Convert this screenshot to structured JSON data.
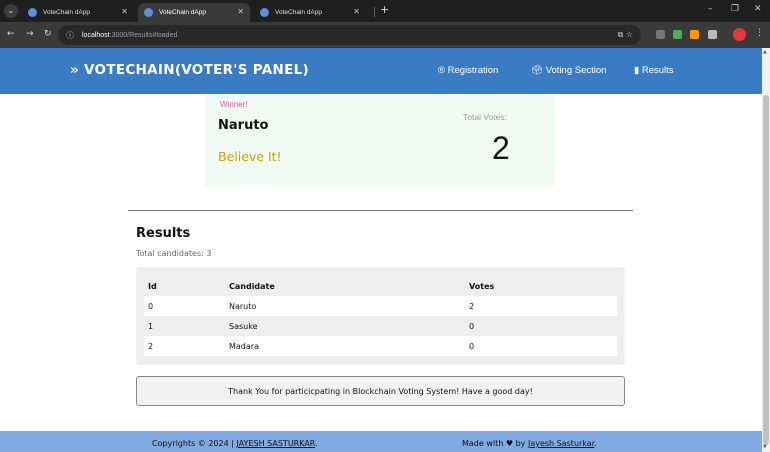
{
  "browser": {
    "tabs": [
      {
        "title": "VoteChain dApp",
        "active": false
      },
      {
        "title": "VoteChain dApp",
        "active": true
      },
      {
        "title": "VoteChain dApp",
        "active": false
      }
    ],
    "url_host": "localhost",
    "url_path": ":3000/Results#loaded"
  },
  "navbar": {
    "brand_icon": "»",
    "brand": "VOTECHAIN(VOTER'S PANEL)",
    "links": [
      {
        "icon": "®",
        "label": "Registration"
      },
      {
        "icon": "🗳",
        "label": "Voting Section"
      },
      {
        "icon": "▮",
        "label": "Results"
      }
    ]
  },
  "winner": {
    "label": "Winner!",
    "name": "Naruto",
    "slogan": "Believe It!",
    "total_votes_label": "Total Votes:",
    "total_votes": "2"
  },
  "results": {
    "title": "Results",
    "subtitle": "Total candidates: 3",
    "headers": [
      "Id",
      "Candidate",
      "Votes"
    ],
    "rows": [
      [
        "0",
        "Naruto",
        "2"
      ],
      [
        "1",
        "Sasuke",
        "0"
      ],
      [
        "2",
        "Madara",
        "0"
      ]
    ]
  },
  "thanks_message": "Thank You for particicpating in Blockchain Voting System! Have a good day!",
  "footer": {
    "copyright_prefix": "Copyrights © 2024 |",
    "copyright_name": "JAYESH SASTURKAR",
    "copyright_suffix": ".",
    "made_prefix": "Made with",
    "heart_icon": "♥",
    "made_by": "by",
    "made_name": "Jayesh Sasturkar",
    "made_suffix": "."
  },
  "colors": {
    "navbar": "#3b7bc4",
    "footer": "#7fa9e0",
    "winner_bg": "#f0fbf5",
    "winner_label": "#e0559b",
    "slogan": "#c8a200"
  }
}
